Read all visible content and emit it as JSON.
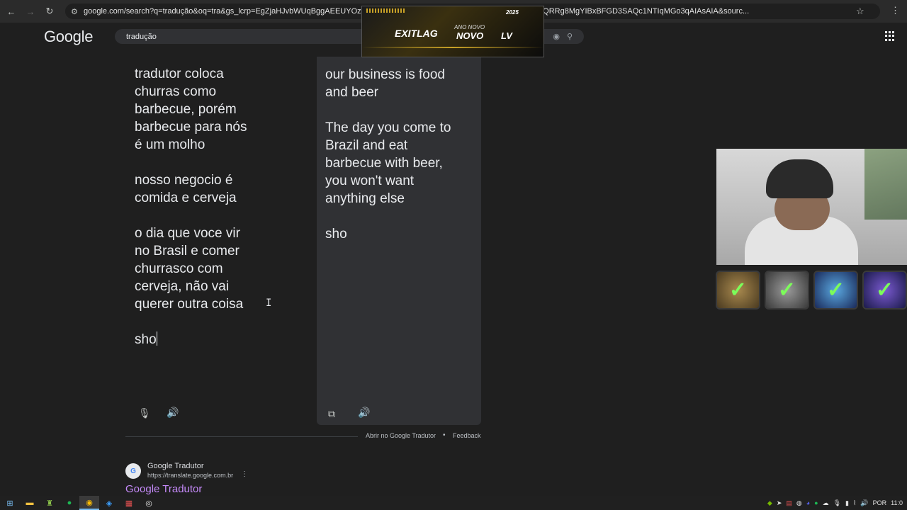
{
  "browser": {
    "url": "google.com/search?q=tradução&oq=tra&gs_lcrp=EgZjaHJvbWUqBggAEEUYOzIGCAEQRRg5MgYIBBBFGDsyBggFEEUYPTIGCAYQRRg8MgYIBxBFGD3SAQc1NTIqMGo3qAIAsAIA&sourc..."
  },
  "google": {
    "logo": "Google",
    "query": "tradução"
  },
  "ad": {
    "brand": "EXITLAG",
    "tagline": "ANO NOVO",
    "novo": "NOVO",
    "lv": "LV",
    "year": "2025"
  },
  "translator": {
    "source_text": "tradutor coloca\nchurras como\nbarbecue, porém\nbarbecue para nós\né um molho\n\nnosso negocio é\ncomida e cerveja\n\no dia que voce vir\nno Brasil e comer\nchurrasco com\ncerveja, não vai\nquerer outra coisa\n\nsho",
    "target_text": "our business is food\nand beer\n\nThe day you come to\nBrazil and eat\nbarbecue with beer,\nyou won't want\nanything else\n\nsho",
    "open_link": "Abrir no Google Tradutor",
    "separator": "•",
    "feedback_link": "Feedback"
  },
  "result": {
    "site_name": "Google Tradutor",
    "site_url": "https://translate.google.com.br",
    "title": "Google Tradutor",
    "favicon_letter": "G"
  },
  "taskbar": {
    "language": "POR",
    "clock": "11:0"
  }
}
